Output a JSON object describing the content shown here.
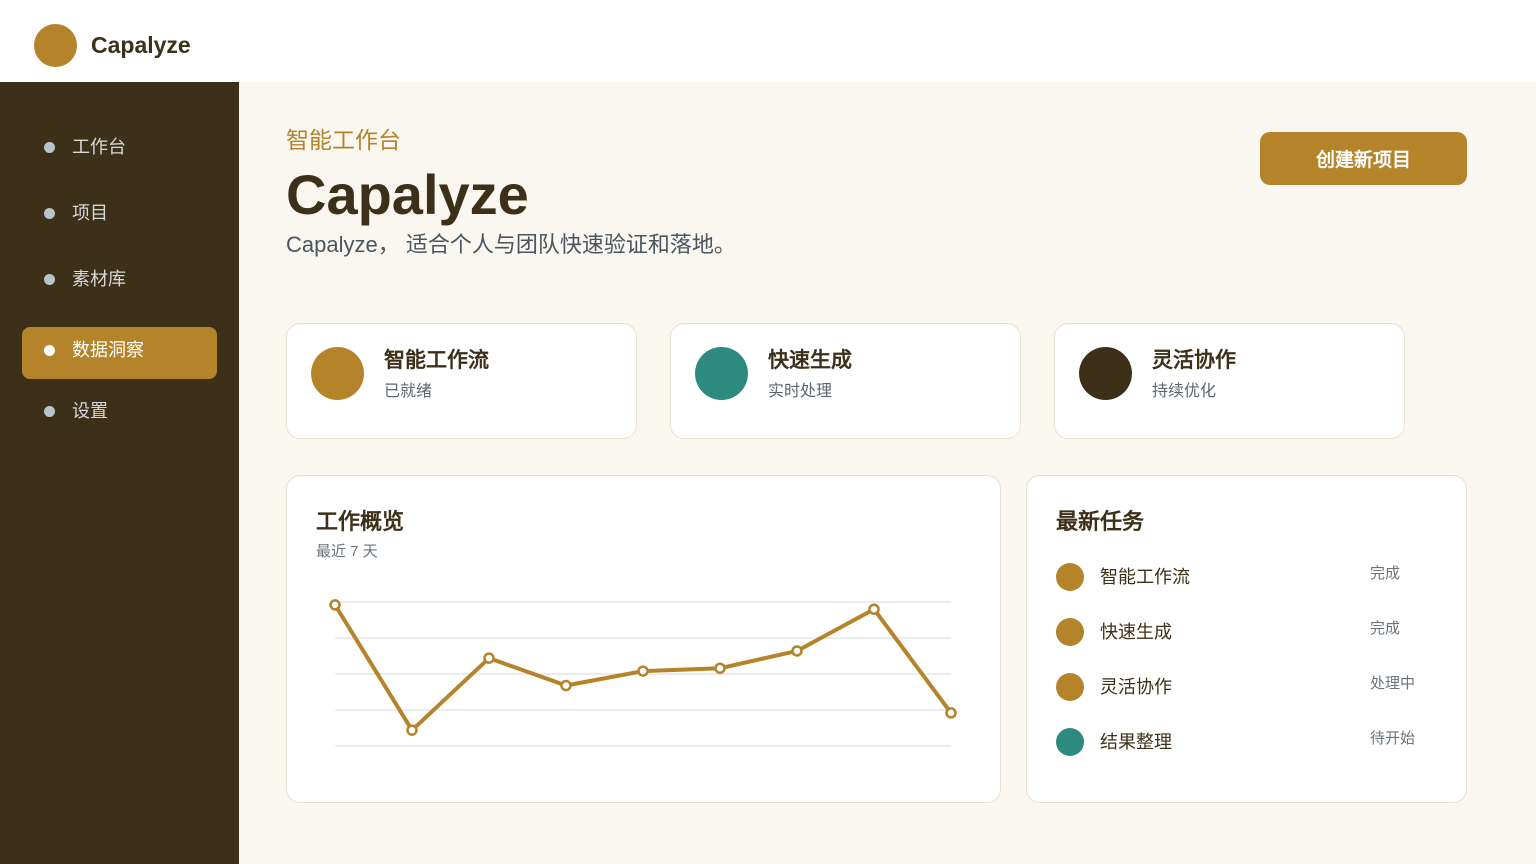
{
  "header": {
    "brand": "Capalyze",
    "logo_color": "#b4832a"
  },
  "sidebar": {
    "items": [
      {
        "label": "工作台",
        "active": false
      },
      {
        "label": "项目",
        "active": false
      },
      {
        "label": "素材库",
        "active": false
      },
      {
        "label": "数据洞察",
        "active": true
      },
      {
        "label": "设置",
        "active": false
      }
    ]
  },
  "main": {
    "eyebrow": "智能工作台",
    "title": "Capalyze",
    "subtitle": "Capalyze， 适合个人与团队快速验证和落地。",
    "create_button": "创建新项目"
  },
  "features": [
    {
      "title": "智能工作流",
      "status": "已就绪",
      "color": "#b4832a"
    },
    {
      "title": "快速生成",
      "status": "实时处理",
      "color": "#2e8a7e"
    },
    {
      "title": "灵活协作",
      "status": "持续优化",
      "color": "#3d3019"
    }
  ],
  "overview": {
    "title": "工作概览",
    "subtitle": "最近 7 天"
  },
  "chart_data": {
    "type": "line",
    "x": [
      1,
      2,
      3,
      4,
      5,
      6,
      7,
      8,
      9
    ],
    "values": [
      98,
      11,
      61,
      42,
      52,
      54,
      66,
      95,
      23
    ],
    "ylim": [
      0,
      100
    ],
    "grid": true,
    "color": "#b4832a"
  },
  "tasks": {
    "title": "最新任务",
    "items": [
      {
        "name": "智能工作流",
        "status": "完成",
        "color": "#b4832a"
      },
      {
        "name": "快速生成",
        "status": "完成",
        "color": "#b4832a"
      },
      {
        "name": "灵活协作",
        "status": "处理中",
        "color": "#b4832a"
      },
      {
        "name": "结果整理",
        "status": "待开始",
        "color": "#2e8a7e"
      }
    ]
  },
  "colors": {
    "accent": "#b4832a",
    "sidebar_bg": "#3d3019",
    "teal": "#2e8a7e",
    "page_bg": "#f9f7ef"
  }
}
